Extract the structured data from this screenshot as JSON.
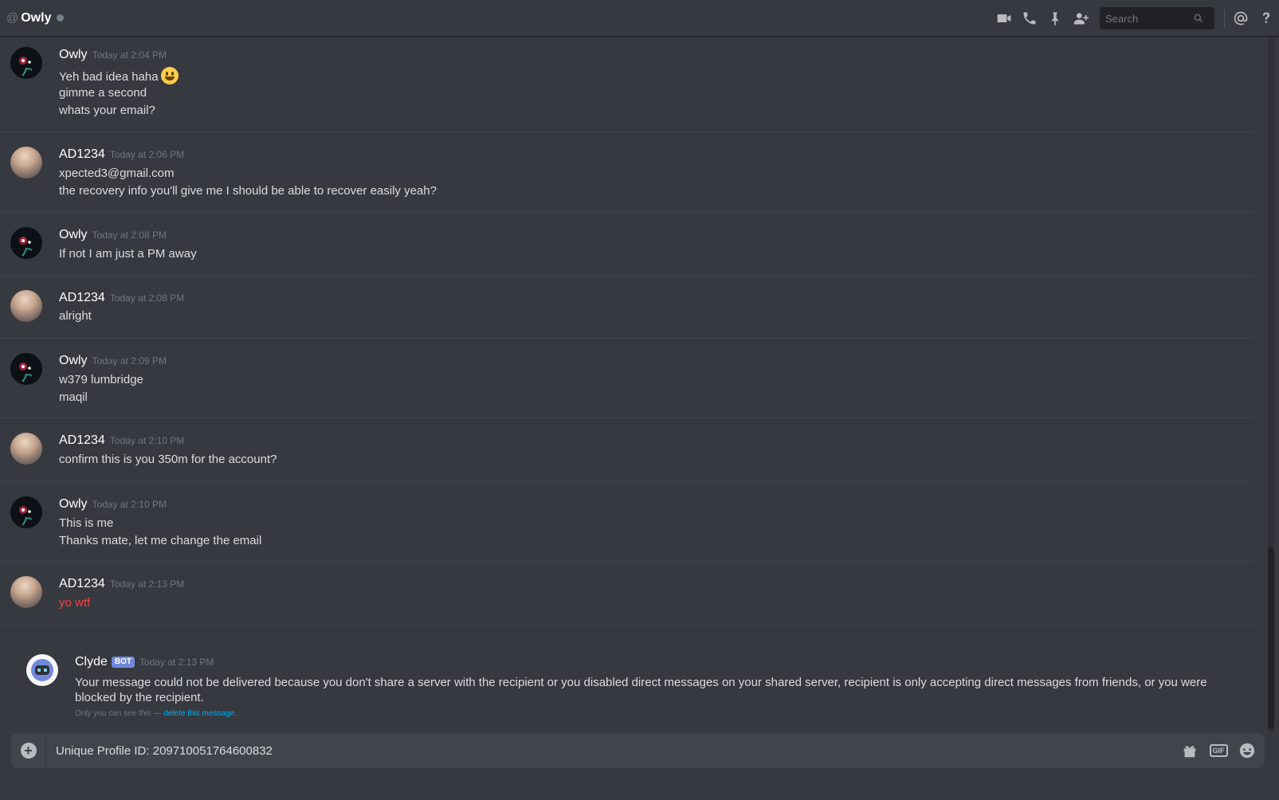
{
  "header": {
    "at_symbol": "@",
    "channel_name": "Owly",
    "search_placeholder": "Search"
  },
  "messages": [
    {
      "author": "Owly",
      "timestamp": "Today at 2:04 PM",
      "lines": [
        "Yeh bad idea haha",
        "gimme a second",
        "whats your email?"
      ]
    },
    {
      "author": "AD1234",
      "timestamp": "Today at 2:06 PM",
      "lines": [
        "xpected3@gmail.com",
        "the recovery info you'll give me I should be able to recover easily yeah?"
      ]
    },
    {
      "author": "Owly",
      "timestamp": "Today at 2:08 PM",
      "lines": [
        "If not I am just a PM away"
      ]
    },
    {
      "author": "AD1234",
      "timestamp": "Today at 2:08 PM",
      "lines": [
        "alright"
      ]
    },
    {
      "author": "Owly",
      "timestamp": "Today at 2:09 PM",
      "lines": [
        "w379 lumbridge",
        "maqil"
      ]
    },
    {
      "author": "AD1234",
      "timestamp": "Today at 2:10 PM",
      "lines": [
        "confirm this is you 350m for the account?"
      ]
    },
    {
      "author": "Owly",
      "timestamp": "Today at 2:10 PM",
      "lines": [
        "This is me",
        "Thanks mate, let me change the email"
      ]
    },
    {
      "author": "AD1234",
      "timestamp": "Today at 2:13 PM",
      "lines": [
        "yo wtf"
      ]
    }
  ],
  "clyde": {
    "author": "Clyde",
    "bot_tag": "BOT",
    "timestamp": "Today at 2:13 PM",
    "body": "Your message could not be delivered because you don't share a server with the recipient or you disabled direct messages on your shared server, recipient is only accepting direct messages from friends, or you were blocked by the recipient.",
    "note_prefix": "Only you can see this — ",
    "note_link": "delete this message."
  },
  "composer": {
    "value": "Unique Profile ID: 209710051764600832",
    "gif_label": "GIF"
  },
  "colors": {
    "background": "#36393f",
    "error_text": "#f04747",
    "link": "#00b0f4",
    "bot_tag": "#7289da"
  }
}
